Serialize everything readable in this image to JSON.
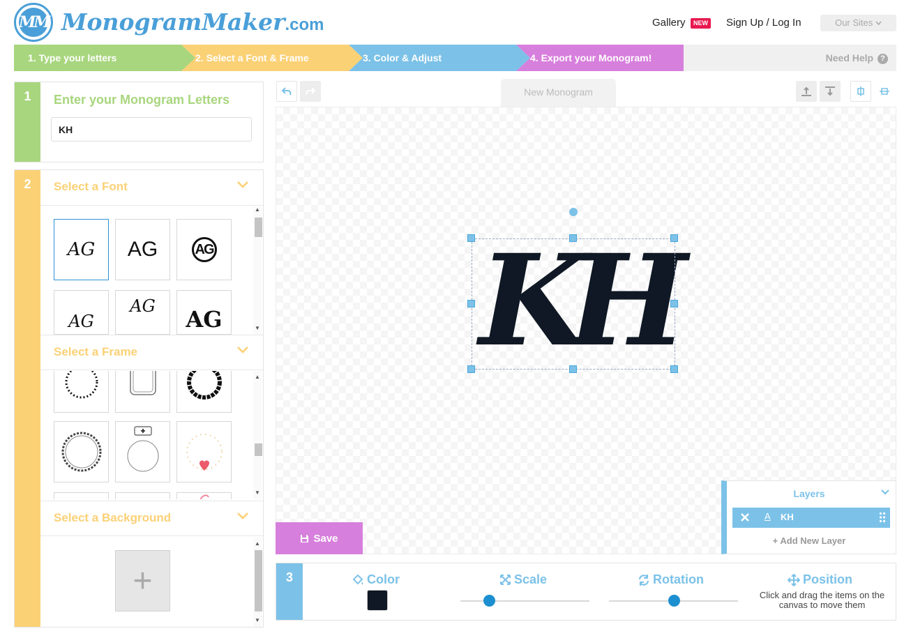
{
  "header": {
    "logo_text_script": "Monogram",
    "logo_text_maker": "Maker",
    "logo_text_domain": ".com",
    "logo_icon_letters": "MM",
    "nav_gallery": "Gallery",
    "nav_new_badge": "NEW",
    "nav_signup": "Sign Up / Log In",
    "our_sites": "Our Sites"
  },
  "steps": [
    {
      "label": "1. Type your letters",
      "color": "#a8d67e"
    },
    {
      "label": "2. Select a Font & Frame",
      "color": "#fbd176"
    },
    {
      "label": "3. Color & Adjust",
      "color": "#7cc2e8"
    },
    {
      "label": "4. Export your Monogram!",
      "color": "#d77fdc"
    }
  ],
  "need_help": "Need Help",
  "panel1": {
    "number": "1",
    "title": "Enter your Monogram Letters",
    "letters_value": "KH"
  },
  "panel2": {
    "number": "2",
    "font_title": "Select a Font",
    "frame_title": "Select a Frame",
    "background_title": "Select a Background",
    "font_thumbs": [
      "AG",
      "AG",
      "AG",
      "AG",
      "AG",
      "AG"
    ],
    "add_background_symbol": "+"
  },
  "editor": {
    "tab_title": "New Monogram",
    "monogram_text": "KH",
    "monogram_color": "#0f1824",
    "save_label": "Save"
  },
  "layers": {
    "title": "Layers",
    "items": [
      {
        "name": "KH",
        "type_icon": "A"
      }
    ],
    "add_label": "+ Add New Layer"
  },
  "panel3": {
    "number": "3",
    "color_label": "Color",
    "scale_label": "Scale",
    "rotation_label": "Rotation",
    "position_label": "Position",
    "position_help": "Click and drag the items on the canvas to move them",
    "scale_level": 0.22,
    "rotation_level": 0.5,
    "swatch_color": "#0f1824"
  },
  "colors": {
    "green": "#a8d67e",
    "yellow": "#fbd176",
    "blue": "#7cc2e8",
    "purple": "#d77fdc",
    "logo_blue": "#4a9fd8"
  }
}
